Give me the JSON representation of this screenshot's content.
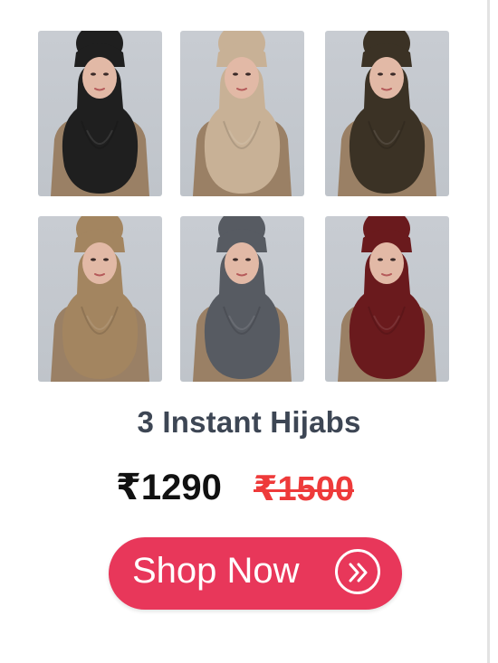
{
  "products": [
    {
      "name": "hijab-black",
      "color": "#1f1f1f"
    },
    {
      "name": "hijab-beige",
      "color": "#c8b196"
    },
    {
      "name": "hijab-dark-brown",
      "color": "#3b3225"
    },
    {
      "name": "hijab-camel",
      "color": "#a38560"
    },
    {
      "name": "hijab-grey",
      "color": "#575b62"
    },
    {
      "name": "hijab-maroon",
      "color": "#6a1a1d"
    }
  ],
  "offer": {
    "title": "3 Instant Hijabs",
    "price_now": "₹1290",
    "price_old": "₹1500"
  },
  "cta": {
    "label": "Shop Now",
    "icon": "double-chevron-right-icon"
  },
  "colors": {
    "accent": "#e8375a",
    "old_price": "#ee3a3a",
    "title": "#3d4654",
    "skin": "#e2b9a6",
    "sweater": "#9a8065"
  }
}
